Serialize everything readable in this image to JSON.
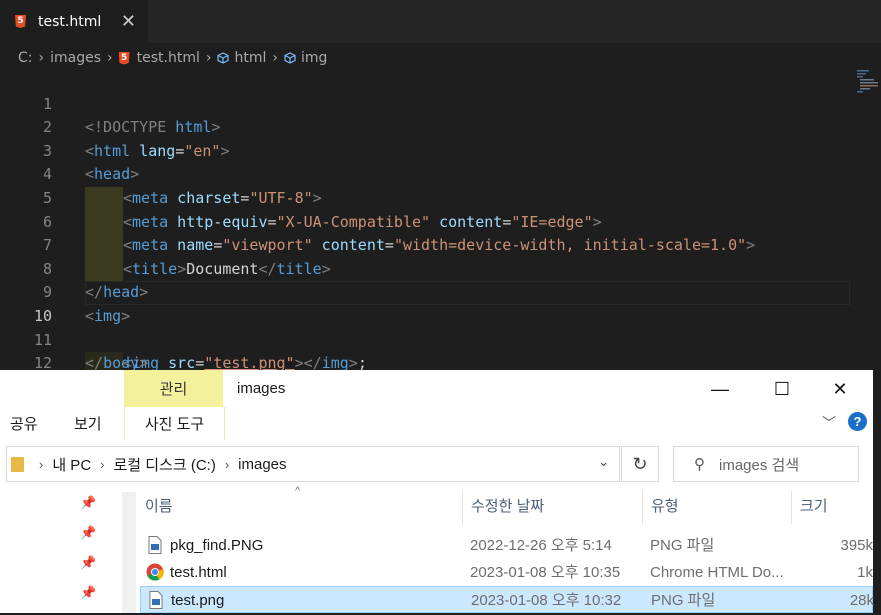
{
  "vscode": {
    "tab": {
      "label": "test.html",
      "close": "✕"
    },
    "breadcrumb": {
      "drive": "C:",
      "folder": "images",
      "file": "test.html",
      "sym1": "html",
      "sym2": "img"
    },
    "lines": [
      {
        "n": "1"
      },
      {
        "n": "2"
      },
      {
        "n": "3"
      },
      {
        "n": "4"
      },
      {
        "n": "5"
      },
      {
        "n": "6"
      },
      {
        "n": "7"
      },
      {
        "n": "8"
      },
      {
        "n": "9"
      },
      {
        "n": "10"
      },
      {
        "n": "11"
      },
      {
        "n": "12"
      }
    ],
    "code": {
      "l1_doctype": "<!DOCTYPE",
      "l1_html": " html",
      "l1_close": ">",
      "l2_open": "<",
      "l2_tag": "html",
      "l2_attr": " lang",
      "l2_eq": "=",
      "l2_val": "\"en\"",
      "l2_close": ">",
      "l3_tag": "head",
      "meta": "meta",
      "charset": " charset",
      "utf8": "\"UTF-8\"",
      "httpequiv": " http-equiv",
      "xua": "\"X-UA-Compatible\"",
      "content": " content",
      "ieedge": "\"IE=edge\"",
      "name": " name",
      "viewport": "\"viewport\"",
      "vpcontent": "\"width=device-width, initial-scale=1.0\"",
      "title": "title",
      "document": "Document",
      "head_close": "head",
      "img": "img",
      "src": " src",
      "testpng": "\"test.png\"",
      "semicolon": ";",
      "body": "body",
      "html": "html"
    }
  },
  "explorer": {
    "ribbon": {
      "manage": "관리",
      "picture_tools": "사진 도구",
      "share": "공유",
      "view": "보기"
    },
    "title": "images",
    "window": {
      "minimize": "—",
      "maximize": "☐",
      "close": "✕"
    },
    "help": "?",
    "address": {
      "pc": "내 PC",
      "disk": "로컬 디스크 (C:)",
      "folder": "images"
    },
    "search_placeholder": "images 검색",
    "columns": {
      "name": "이름",
      "date": "수정한 날짜",
      "type": "유형",
      "size": "크기"
    },
    "files": [
      {
        "name": "pkg_find.PNG",
        "date": "2022-12-26 오후 5:14",
        "type": "PNG 파일",
        "size": "395k"
      },
      {
        "name": "test.html",
        "date": "2023-01-08 오후 10:35",
        "type": "Chrome HTML Do...",
        "size": "1k"
      },
      {
        "name": "test.png",
        "date": "2023-01-08 오후 10:32",
        "type": "PNG 파일",
        "size": "28k"
      }
    ]
  }
}
